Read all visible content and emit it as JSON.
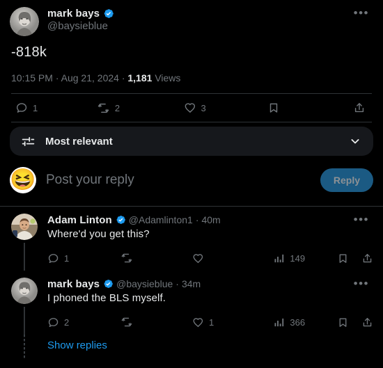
{
  "post": {
    "author": {
      "display_name": "mark bays",
      "handle": "@baysieblue",
      "verified": true,
      "avatar": "portrait-engraving-avatar"
    },
    "text": "-818k",
    "timestamp": "10:15 PM",
    "separator": "·",
    "date": "Aug 21, 2024",
    "views_count": "1,181",
    "views_label": "Views",
    "more_icon": "more-horizontal-icon",
    "actions": [
      {
        "name": "reply",
        "icon": "reply-bubble-icon",
        "count": "1"
      },
      {
        "name": "repost",
        "icon": "repost-icon",
        "count": "2"
      },
      {
        "name": "like",
        "icon": "heart-icon",
        "count": "3"
      },
      {
        "name": "bookmark",
        "icon": "bookmark-icon",
        "count": ""
      },
      {
        "name": "share",
        "icon": "share-upload-icon",
        "count": ""
      }
    ]
  },
  "sort_bar": {
    "icon": "sliders-filter-icon",
    "label": "Most relevant",
    "chevron": "chevron-down-icon"
  },
  "composer": {
    "avatar_emoji": "😆",
    "placeholder": "Post your reply",
    "button_label": "Reply",
    "button_color": "#1b5a83",
    "button_text_color": "#8d9195"
  },
  "replies": [
    {
      "display_name": "Adam Linton",
      "handle": "@Adamlinton1",
      "separator": "·",
      "time": "40m",
      "verified": true,
      "avatar": "photo-man-light-shirt-avatar",
      "text": "Where'd you get this?",
      "more_icon": "more-horizontal-icon",
      "actions": [
        {
          "name": "reply",
          "icon": "reply-bubble-icon",
          "count": "1"
        },
        {
          "name": "repost",
          "icon": "repost-icon",
          "count": ""
        },
        {
          "name": "like",
          "icon": "heart-icon",
          "count": ""
        },
        {
          "name": "views",
          "icon": "analytics-bars-icon",
          "count": "149"
        },
        {
          "name": "bookmark",
          "icon": "bookmark-icon",
          "count": ""
        },
        {
          "name": "share",
          "icon": "share-upload-icon",
          "count": ""
        }
      ]
    },
    {
      "display_name": "mark bays",
      "handle": "@baysieblue",
      "separator": "·",
      "time": "34m",
      "verified": true,
      "avatar": "portrait-engraving-avatar",
      "text": "I phoned the BLS myself.",
      "more_icon": "more-horizontal-icon",
      "actions": [
        {
          "name": "reply",
          "icon": "reply-bubble-icon",
          "count": "2"
        },
        {
          "name": "repost",
          "icon": "repost-icon",
          "count": ""
        },
        {
          "name": "like",
          "icon": "heart-icon",
          "count": "1"
        },
        {
          "name": "views",
          "icon": "analytics-bars-icon",
          "count": "366"
        },
        {
          "name": "bookmark",
          "icon": "bookmark-icon",
          "count": ""
        },
        {
          "name": "share",
          "icon": "share-upload-icon",
          "count": ""
        }
      ]
    }
  ],
  "show_replies": {
    "label": "Show replies"
  },
  "colors": {
    "background": "#000000",
    "text_primary": "#e7e9ea",
    "text_secondary": "#71767b",
    "accent_blue": "#1d9bf0",
    "divider": "#2f3336",
    "surface": "#16181c"
  }
}
